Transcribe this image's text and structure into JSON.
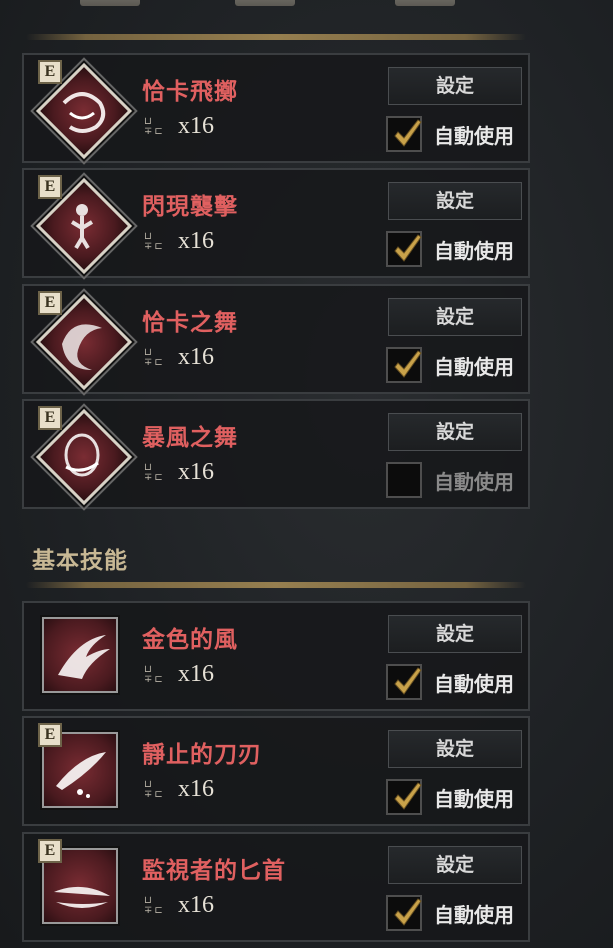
{
  "tabs": [
    "",
    "",
    ""
  ],
  "basic_section_title": "基本技能",
  "skills": [
    {
      "name": "恰卡飛擲",
      "count": "x16",
      "set_label": "設定",
      "auto_label": "自動使用",
      "auto_checked": true,
      "badge": "E",
      "frame": "diamond",
      "icon": "chakram-throw-icon"
    },
    {
      "name": "閃現襲擊",
      "count": "x16",
      "set_label": "設定",
      "auto_label": "自動使用",
      "auto_checked": true,
      "badge": "E",
      "frame": "diamond",
      "icon": "flash-strike-icon"
    },
    {
      "name": "恰卡之舞",
      "count": "x16",
      "set_label": "設定",
      "auto_label": "自動使用",
      "auto_checked": true,
      "badge": "E",
      "frame": "diamond",
      "icon": "chakram-dance-icon"
    },
    {
      "name": "暴風之舞",
      "count": "x16",
      "set_label": "設定",
      "auto_label": "自動使用",
      "auto_checked": false,
      "badge": "E",
      "frame": "diamond",
      "icon": "storm-dance-icon"
    },
    {
      "name": "金色的風",
      "count": "x16",
      "set_label": "設定",
      "auto_label": "自動使用",
      "auto_checked": true,
      "badge": "",
      "frame": "square",
      "icon": "golden-wind-icon"
    },
    {
      "name": "靜止的刀刃",
      "count": "x16",
      "set_label": "設定",
      "auto_label": "自動使用",
      "auto_checked": true,
      "badge": "E",
      "frame": "square",
      "icon": "still-blade-icon"
    },
    {
      "name": "監視者的匕首",
      "count": "x16",
      "set_label": "設定",
      "auto_label": "自動使用",
      "auto_checked": true,
      "badge": "E",
      "frame": "square",
      "icon": "watcher-dagger-icon"
    }
  ],
  "colors": {
    "skill_name": "#e06060",
    "section_title": "#c8b894",
    "check": "#c9a24a"
  }
}
